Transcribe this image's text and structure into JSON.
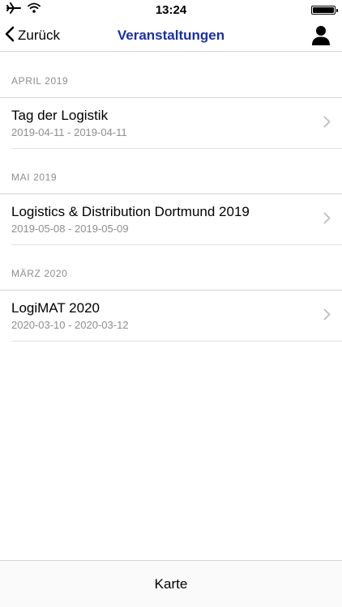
{
  "status_bar": {
    "time": "13:24",
    "icons": [
      "airplane-icon",
      "wifi-icon",
      "battery-icon"
    ]
  },
  "nav": {
    "back_label": "Zurück",
    "title": "Veranstaltungen",
    "title_color": "#1b2fa8",
    "right_icon": "person-icon"
  },
  "sections": [
    {
      "header": "APRIL 2019",
      "items": [
        {
          "title": "Tag der Logistik",
          "dates": "2019-04-11 - 2019-04-11"
        }
      ]
    },
    {
      "header": "MAI 2019",
      "items": [
        {
          "title": "Logistics & Distribution Dortmund 2019",
          "dates": "2019-05-08 - 2019-05-09"
        }
      ]
    },
    {
      "header": "MÄRZ 2020",
      "items": [
        {
          "title": "LogiMAT 2020",
          "dates": "2020-03-10 - 2020-03-12"
        }
      ]
    }
  ],
  "bottom_bar": {
    "button_label": "Karte"
  }
}
